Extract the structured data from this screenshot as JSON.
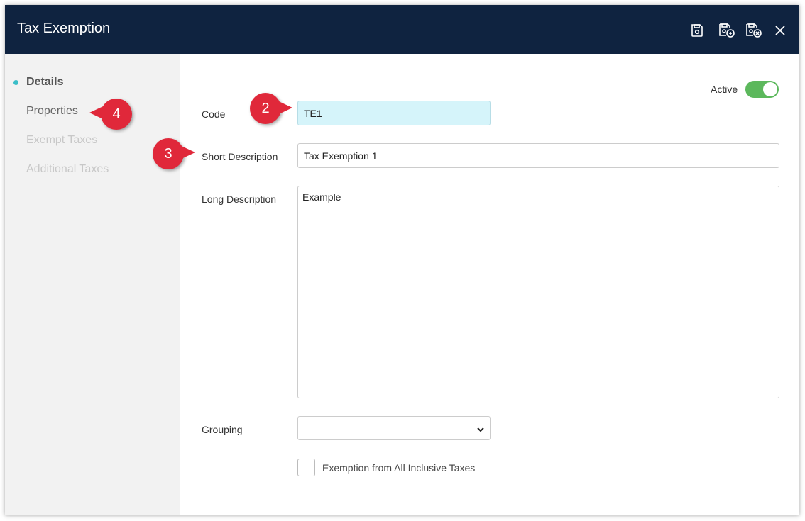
{
  "window": {
    "title": "Tax Exemption",
    "toolbar": [
      {
        "name": "save-icon"
      },
      {
        "name": "save-and-new-icon"
      },
      {
        "name": "save-and-close-icon"
      },
      {
        "name": "close-icon"
      }
    ]
  },
  "sidebar": {
    "items": [
      {
        "label": "Details",
        "state": "active"
      },
      {
        "label": "Properties",
        "state": "normal"
      },
      {
        "label": "Exempt Taxes",
        "state": "disabled"
      },
      {
        "label": "Additional Taxes",
        "state": "disabled"
      }
    ]
  },
  "form": {
    "active_label": "Active",
    "active_on": true,
    "code_label": "Code",
    "code_value": "TE1",
    "short_desc_label": "Short Description",
    "short_desc_value": "Tax Exemption 1",
    "long_desc_label": "Long Description",
    "long_desc_value": "Example",
    "grouping_label": "Grouping",
    "grouping_value": "",
    "exemption_label": "Exemption from All Inclusive Taxes",
    "exemption_checked": false
  },
  "callouts": [
    "2",
    "3",
    "4"
  ],
  "colors": {
    "titlebar": "#0f2340",
    "accent": "#3bbec8",
    "toggle_on": "#5cb85c",
    "callout": "#e0283a",
    "code_field_bg": "#d5f4fa"
  }
}
